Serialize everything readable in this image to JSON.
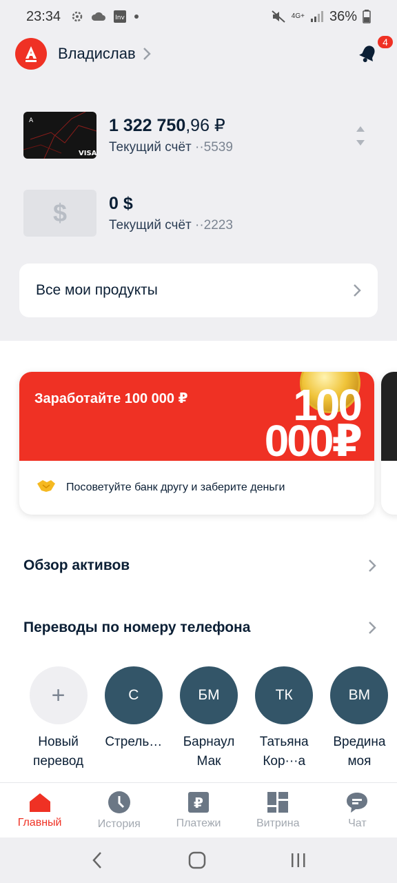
{
  "status_bar": {
    "time": "23:34",
    "battery": "36%",
    "network": "4G+"
  },
  "header": {
    "user_name": "Владислав",
    "notifications_count": "4"
  },
  "accounts": [
    {
      "amount_int": "1 322 750",
      "amount_frac": ",96 ₽",
      "label": "Текущий счёт",
      "number": "··5539"
    },
    {
      "amount_int": "0 $",
      "amount_frac": "",
      "label": "Текущий счёт",
      "number": "··2223"
    }
  ],
  "products_link": "Все мои продукты",
  "promo": {
    "title": "Заработайте 100 000 ₽",
    "big_line1": "100",
    "big_line2": "000₽",
    "subtitle": "Посоветуйте банк другу и заберите деньги"
  },
  "assets_link": "Обзор активов",
  "transfers_title": "Переводы по номеру телефона",
  "contacts": [
    {
      "initials": "+",
      "name": "Новый перевод"
    },
    {
      "initials": "С",
      "name": "Стрель…"
    },
    {
      "initials": "БМ",
      "name": "Барнаул Мак"
    },
    {
      "initials": "ТК",
      "name": "Татьяна Кор···а"
    },
    {
      "initials": "ВМ",
      "name": "Вредина моя"
    }
  ],
  "tabs": [
    {
      "label": "Главный",
      "icon": "home-icon"
    },
    {
      "label": "История",
      "icon": "clock-icon"
    },
    {
      "label": "Платежи",
      "icon": "ruble-icon"
    },
    {
      "label": "Витрина",
      "icon": "showcase-icon"
    },
    {
      "label": "Чат",
      "icon": "chat-icon"
    }
  ],
  "colors": {
    "brand": "#ef3124",
    "avatar": "#335568",
    "text": "#0b1f35"
  }
}
